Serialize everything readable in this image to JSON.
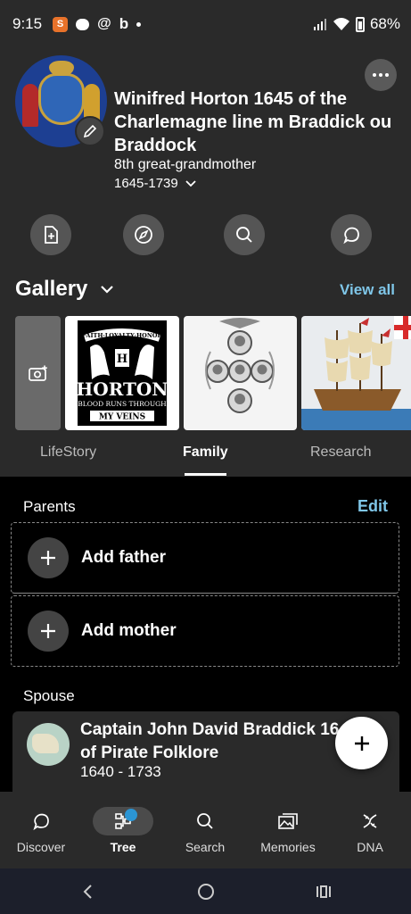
{
  "status_bar": {
    "time": "9:15",
    "app_badge": "S",
    "battery": "68%"
  },
  "profile": {
    "name": "Winifred Horton 1645 of the Charlemagne line m Braddick ou Braddock",
    "relationship": "8th great-grandmother",
    "lifespan": "1645-1739"
  },
  "actions": [
    {
      "icon": "add-document-icon"
    },
    {
      "icon": "compass-icon"
    },
    {
      "icon": "search-icon"
    },
    {
      "icon": "comment-icon"
    }
  ],
  "gallery": {
    "title": "Gallery",
    "view_all": "View all",
    "horton_image": {
      "top_text": "FAITH·LOYALTY·HONOR",
      "crest_letter": "H",
      "name": "HORTON",
      "line1": "BLOOD RUNS THROUGH",
      "line2": "MY VEINS"
    }
  },
  "tabs": [
    {
      "label": "LifeStory",
      "active": false
    },
    {
      "label": "Family",
      "active": true
    },
    {
      "label": "Research",
      "active": false
    }
  ],
  "family": {
    "parents_label": "Parents",
    "edit_label": "Edit",
    "add_father": "Add father",
    "add_mother": "Add mother",
    "spouse_label": "Spouse",
    "spouse": {
      "name_line1": "Captain John David Braddick 16",
      "name_line2": "of Pirate Folklore",
      "dates": "1640 - 1733"
    }
  },
  "bottom_nav": [
    {
      "label": "Discover",
      "icon": "discover-icon",
      "active": false
    },
    {
      "label": "Tree",
      "icon": "tree-icon",
      "active": true
    },
    {
      "label": "Search",
      "icon": "search-icon",
      "active": false
    },
    {
      "label": "Memories",
      "icon": "memories-icon",
      "active": false
    },
    {
      "label": "DNA",
      "icon": "dna-icon",
      "active": false
    }
  ],
  "colors": {
    "accent_link": "#7fc6e8",
    "header_bg": "#2a2a2a",
    "notification_dot": "#2b95d4"
  }
}
